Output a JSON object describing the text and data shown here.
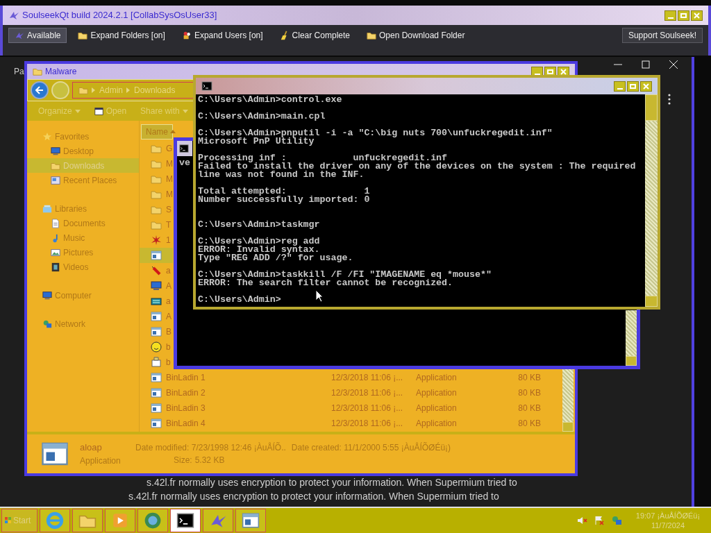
{
  "soulseek": {
    "title": "SoulseekQt build 2024.2.1 [CollabSysOsUser33]",
    "toolbar": [
      {
        "kind": "status",
        "label": "Available",
        "selected": true
      },
      {
        "kind": "folder",
        "label": "Expand Folders [on]",
        "selected": false
      },
      {
        "kind": "users",
        "label": "Expand Users [on]",
        "selected": false
      },
      {
        "kind": "broom",
        "label": "Clear Complete",
        "selected": false
      },
      {
        "kind": "folder",
        "label": "Open Download Folder",
        "selected": false
      }
    ],
    "support": "Support Soulseek!"
  },
  "browser": {
    "tab_fragment": "Pa",
    "messages": [
      "s.42l.fr normally uses encryption to protect your information. When Supermium tried to",
      "s.42l.fr normally uses encryption to protect your information. When Supermium tried to"
    ]
  },
  "explorer": {
    "title": "Malware",
    "breadcrumb": [
      "Admin",
      "Downloads"
    ],
    "commands": [
      {
        "label": "Organize",
        "kind": "menu"
      },
      {
        "label": "Open",
        "kind": "open"
      },
      {
        "label": "Share with",
        "kind": "menu"
      }
    ],
    "nav": [
      {
        "label": "Favorites",
        "kind": "star",
        "selected": false,
        "children": [
          {
            "label": "Desktop",
            "kind": "desktop",
            "selected": false
          },
          {
            "label": "Downloads",
            "kind": "folder",
            "selected": true
          },
          {
            "label": "Recent Places",
            "kind": "recent",
            "selected": false
          }
        ]
      },
      {
        "label": "Libraries",
        "kind": "library",
        "selected": false,
        "children": [
          {
            "label": "Documents",
            "kind": "doc",
            "selected": false
          },
          {
            "label": "Music",
            "kind": "music",
            "selected": false
          },
          {
            "label": "Pictures",
            "kind": "picture",
            "selected": false
          },
          {
            "label": "Videos",
            "kind": "video",
            "selected": false
          }
        ]
      },
      {
        "label": "Computer",
        "kind": "computer",
        "selected": false
      },
      {
        "label": "Network",
        "kind": "network",
        "selected": false
      }
    ],
    "column": "Name",
    "files": [
      {
        "kind": "folder",
        "name": "G",
        "selected": false
      },
      {
        "kind": "folder",
        "name": "M",
        "selected": false
      },
      {
        "kind": "folder",
        "name": "M",
        "selected": false
      },
      {
        "kind": "folder",
        "name": "M",
        "selected": false
      },
      {
        "kind": "folder",
        "name": "S",
        "selected": false
      },
      {
        "kind": "folder",
        "name": "T",
        "selected": false
      },
      {
        "kind": "burst",
        "name": "1",
        "selected": false
      },
      {
        "kind": "app",
        "selected": true
      },
      {
        "kind": "dynamite",
        "name": "a",
        "selected": false
      },
      {
        "kind": "computer",
        "name": "A",
        "selected": false
      },
      {
        "kind": "keyboard",
        "name": "a",
        "selected": false
      },
      {
        "kind": "app",
        "name": "A",
        "selected": false
      },
      {
        "kind": "app",
        "name": "B",
        "selected": false
      },
      {
        "kind": "smiley",
        "name": "b",
        "selected": false
      },
      {
        "kind": "installer",
        "name": "b",
        "selected": false
      },
      {
        "kind": "app",
        "name": "BinLadin 1",
        "date": "12/3/2018 11:06 ¡...",
        "type": "Application",
        "size": "80 KB",
        "selected": false
      },
      {
        "kind": "app",
        "name": "BinLadin 2",
        "date": "12/3/2018 11:06 ¡...",
        "type": "Application",
        "size": "80 KB",
        "selected": false
      },
      {
        "kind": "app",
        "name": "BinLadin 3",
        "date": "12/3/2018 11:06 ¡...",
        "type": "Application",
        "size": "80 KB",
        "selected": false
      },
      {
        "kind": "app",
        "name": "BinLadin 4",
        "date": "12/3/2018 11:06 ¡...",
        "type": "Application",
        "size": "80 KB",
        "selected": false
      }
    ],
    "details": {
      "name": "aloap",
      "type": "Application",
      "modified": "Date modified: 7/23/1998 12:46 ¡ÀuÅÍÕ..",
      "created": "Date created: 11/1/2000 5:55 ¡ÀuÅÍÕØÉü¡)",
      "size_label": "Size:",
      "size": "5.32 KB"
    }
  },
  "console_back": {
    "output": "ve"
  },
  "console": {
    "blocks": [
      "C:\\Users\\Admin>control.exe",
      "C:\\Users\\Admin>main.cpl",
      "C:\\Users\\Admin>pnputil -i -a \"C:\\big nuts 700\\unfuckregedit.inf\"\nMicrosoft PnP Utility",
      "Processing inf :            unfuckregedit.inf\nFailed to install the driver on any of the devices on the system : The required\nline was not found in the INF.",
      "Total attempted:              1\nNumber successfully imported: 0\n\n\nC:\\Users\\Admin>taskmgr",
      "C:\\Users\\Admin>reg add\nERROR: Invalid syntax.\nType \"REG ADD /?\" for usage.",
      "C:\\Users\\Admin>taskkill /F /FI \"IMAGENAME eq *mouse*\"\nERROR: The search filter cannot be recognized.",
      "C:\\Users\\Admin>"
    ]
  },
  "taskbar": {
    "start": "Start",
    "apps": [
      {
        "kind": "ie",
        "active": false
      },
      {
        "kind": "folder",
        "active": false
      },
      {
        "kind": "media",
        "active": false
      },
      {
        "kind": "globe",
        "active": false
      },
      {
        "kind": "cmd",
        "active": true
      },
      {
        "kind": "bird",
        "active": false
      },
      {
        "kind": "window",
        "active": false
      }
    ],
    "tray": [
      {
        "kind": "speaker"
      },
      {
        "kind": "flag"
      },
      {
        "kind": "network"
      }
    ],
    "time": "19:07 ¡ÀuÅÍÕØÉü¡",
    "date": "11/7/2024"
  }
}
